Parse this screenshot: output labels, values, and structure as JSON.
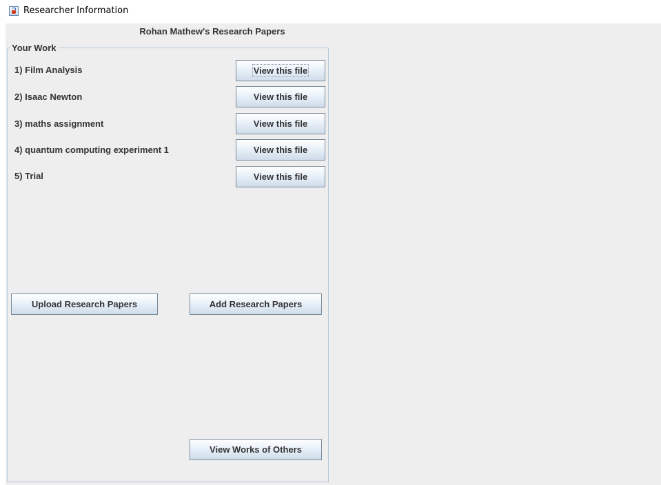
{
  "window": {
    "title": "Researcher Information",
    "icon": "java-icon"
  },
  "page": {
    "title": "Rohan Mathew's Research Papers"
  },
  "work_group": {
    "legend": "Your Work",
    "items": [
      {
        "label": "1) Film Analysis",
        "button": "View this file"
      },
      {
        "label": "2) Isaac Newton",
        "button": "View this file"
      },
      {
        "label": "3) maths assignment",
        "button": "View this file"
      },
      {
        "label": "4) quantum computing experiment 1",
        "button": "View this file"
      },
      {
        "label": "5) Trial",
        "button": "View this file"
      }
    ]
  },
  "actions": {
    "upload_label": "Upload Research Papers",
    "add_label": "Add Research Papers",
    "view_others_label": "View Works of Others"
  }
}
